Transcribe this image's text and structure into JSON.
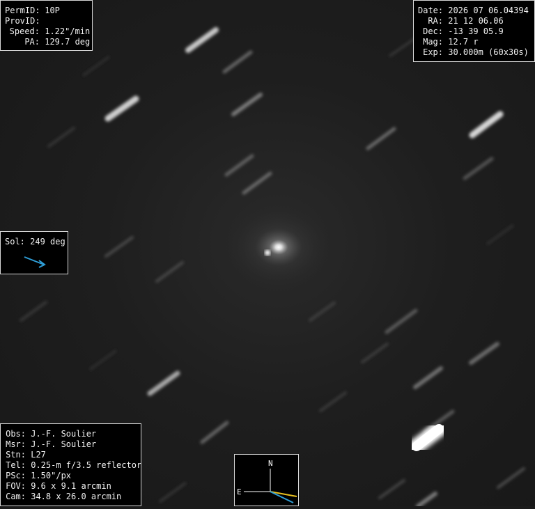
{
  "target_panel": {
    "rows": [
      {
        "key": "PermID:",
        "value": "10P"
      },
      {
        "key": "ProvID:",
        "value": ""
      },
      {
        "key": "Speed:",
        "value": "1.22\"/min"
      },
      {
        "key": "PA:",
        "value": "129.7 deg"
      }
    ]
  },
  "observation_panel": {
    "rows": [
      {
        "key": "Date:",
        "value": "2026 07 06.04394"
      },
      {
        "key": "RA:",
        "value": "21 12 06.06"
      },
      {
        "key": "Dec:",
        "value": "-13 39 05.9"
      },
      {
        "key": "Mag:",
        "value": "12.7 r"
      },
      {
        "key": "Exp:",
        "value": "30.000m (60x30s)"
      }
    ]
  },
  "sol_panel": {
    "key": "Sol:",
    "value": "249 deg",
    "arrow_color": "#2f9fd8",
    "arrow_icon": "arrow-icon"
  },
  "station_panel": {
    "rows": [
      {
        "key": "Obs:",
        "value": "J.-F. Soulier"
      },
      {
        "key": "Msr:",
        "value": "J.-F. Soulier"
      },
      {
        "key": "Stn:",
        "value": "L27"
      },
      {
        "key": "Tel:",
        "value": "0.25-m f/3.5 reflector"
      },
      {
        "key": "PSc:",
        "value": "1.50\"/px"
      },
      {
        "key": "FOV:",
        "value": "9.6 x 9.1 arcmin"
      },
      {
        "key": "Cam:",
        "value": "34.8 x 26.0 arcmin"
      }
    ]
  },
  "compass": {
    "north_label": "N",
    "east_label": "E",
    "motion_color": "#e8c020",
    "sun_color": "#2f9fd8",
    "axis_color": "#ffffff"
  }
}
